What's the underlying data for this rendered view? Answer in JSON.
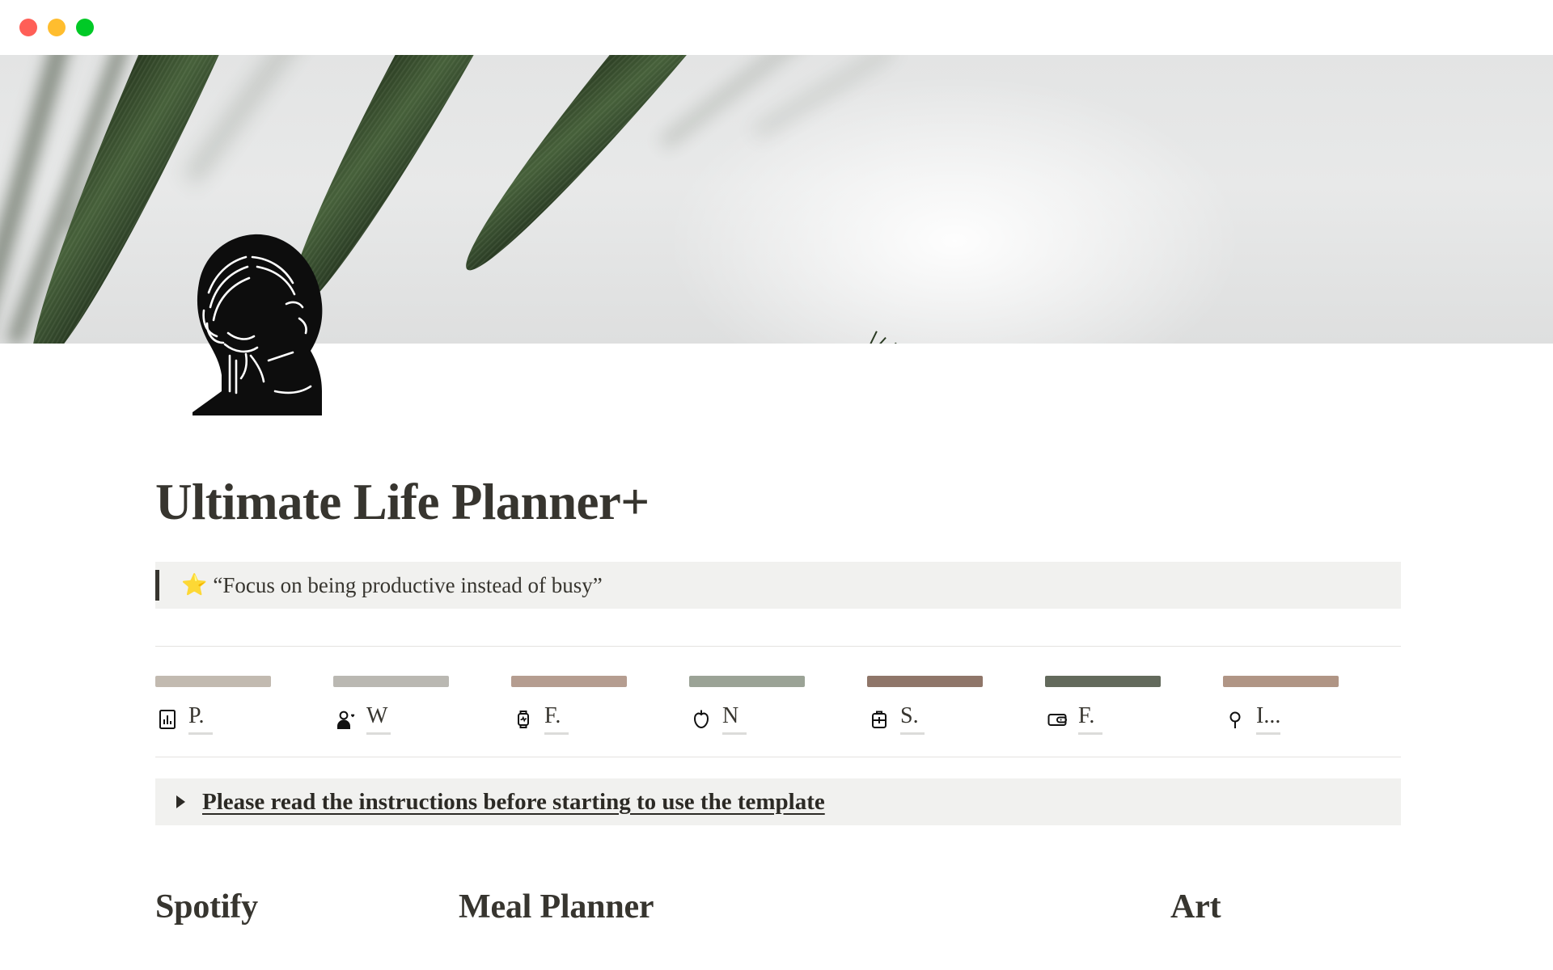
{
  "window": {
    "traffic_lights": [
      {
        "name": "close",
        "color": "#ff5f57"
      },
      {
        "name": "minimize",
        "color": "#ffbd2e"
      },
      {
        "name": "maximize",
        "color": "#00c926"
      }
    ]
  },
  "cover": {
    "description": "green palm leaves on light gray background",
    "background_color": "#e6e7e7",
    "leaf_color": "#2f4226"
  },
  "page_icon": {
    "name": "classical-bust-icon",
    "color": "#0d0d0d"
  },
  "page": {
    "title": "Ultimate Life Planner+"
  },
  "callout": {
    "emoji": "⭐",
    "icon_name": "star-emoji",
    "text": "“Focus on being productive instead of busy”",
    "background": "#f1f1ef",
    "bar_color": "#37352f"
  },
  "cards": [
    {
      "icon": "bar-chart-icon",
      "label": "P.",
      "bar_color": "#c2bab0"
    },
    {
      "icon": "person-heart-icon",
      "label": "W",
      "bar_color": "#bab8b2"
    },
    {
      "icon": "smartwatch-icon",
      "label": "F.",
      "bar_color": "#b59d90"
    },
    {
      "icon": "apple-icon",
      "label": "N",
      "bar_color": "#9ba396"
    },
    {
      "icon": "first-aid-kit-icon",
      "label": "S.",
      "bar_color": "#8f7669"
    },
    {
      "icon": "wallet-icon",
      "label": "F.",
      "bar_color": "#636a5c"
    },
    {
      "icon": "map-pin-icon",
      "label": "I...",
      "bar_color": "#b09585"
    }
  ],
  "toggle": {
    "arrow_icon": "triangle-right-icon",
    "text": "Please read the instructions before starting to use the template",
    "background": "#f1f1ef"
  },
  "bottom_sections": [
    {
      "heading": "Spotify"
    },
    {
      "heading": "Meal Planner"
    },
    {
      "heading": "Art"
    }
  ]
}
